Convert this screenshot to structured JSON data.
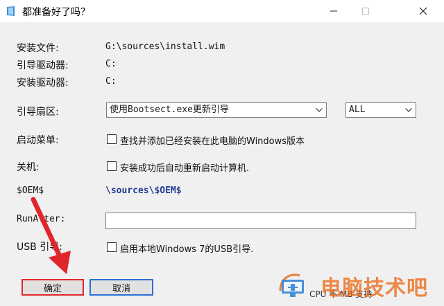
{
  "window": {
    "title": "都准备好了吗？"
  },
  "fields": {
    "install_file_label": "安装文件:",
    "install_file_value": "G:\\sources\\install.wim",
    "boot_drive_label": "引导驱动器:",
    "boot_drive_value": "C:",
    "install_drive_label": "安装驱动器:",
    "install_drive_value": "C:",
    "boot_sector_label": "引导扇区:",
    "boot_sector_selected": "使用Bootsect.exe更新引导",
    "boot_sector_mode_selected": "ALL",
    "boot_menu_label": "启动菜单:",
    "boot_menu_checkbox": "查找并添加已经安装在此电脑的Windows版本",
    "boot_menu_checked": false,
    "shutdown_label": "关机:",
    "shutdown_checkbox": "安装成功后自动重新启动计算机.",
    "shutdown_checked": false,
    "oem_label": "$OEM$",
    "oem_value": "\\sources\\$OEM$",
    "run_after_label": "RunAfter:",
    "run_after_value": "",
    "usb_label": "USB 引导:",
    "usb_checkbox": "启用本地Windows 7的USB引导.",
    "usb_checked": false
  },
  "buttons": {
    "ok": "确定",
    "cancel": "取消"
  },
  "footer": {
    "cpu_text": "CPU 不 MB 支持"
  },
  "watermark": {
    "text": "电脑技术吧"
  },
  "colors": {
    "accent_red": "#e0262b",
    "accent_blue": "#2a6fd0",
    "watermark": "#e8640c"
  }
}
